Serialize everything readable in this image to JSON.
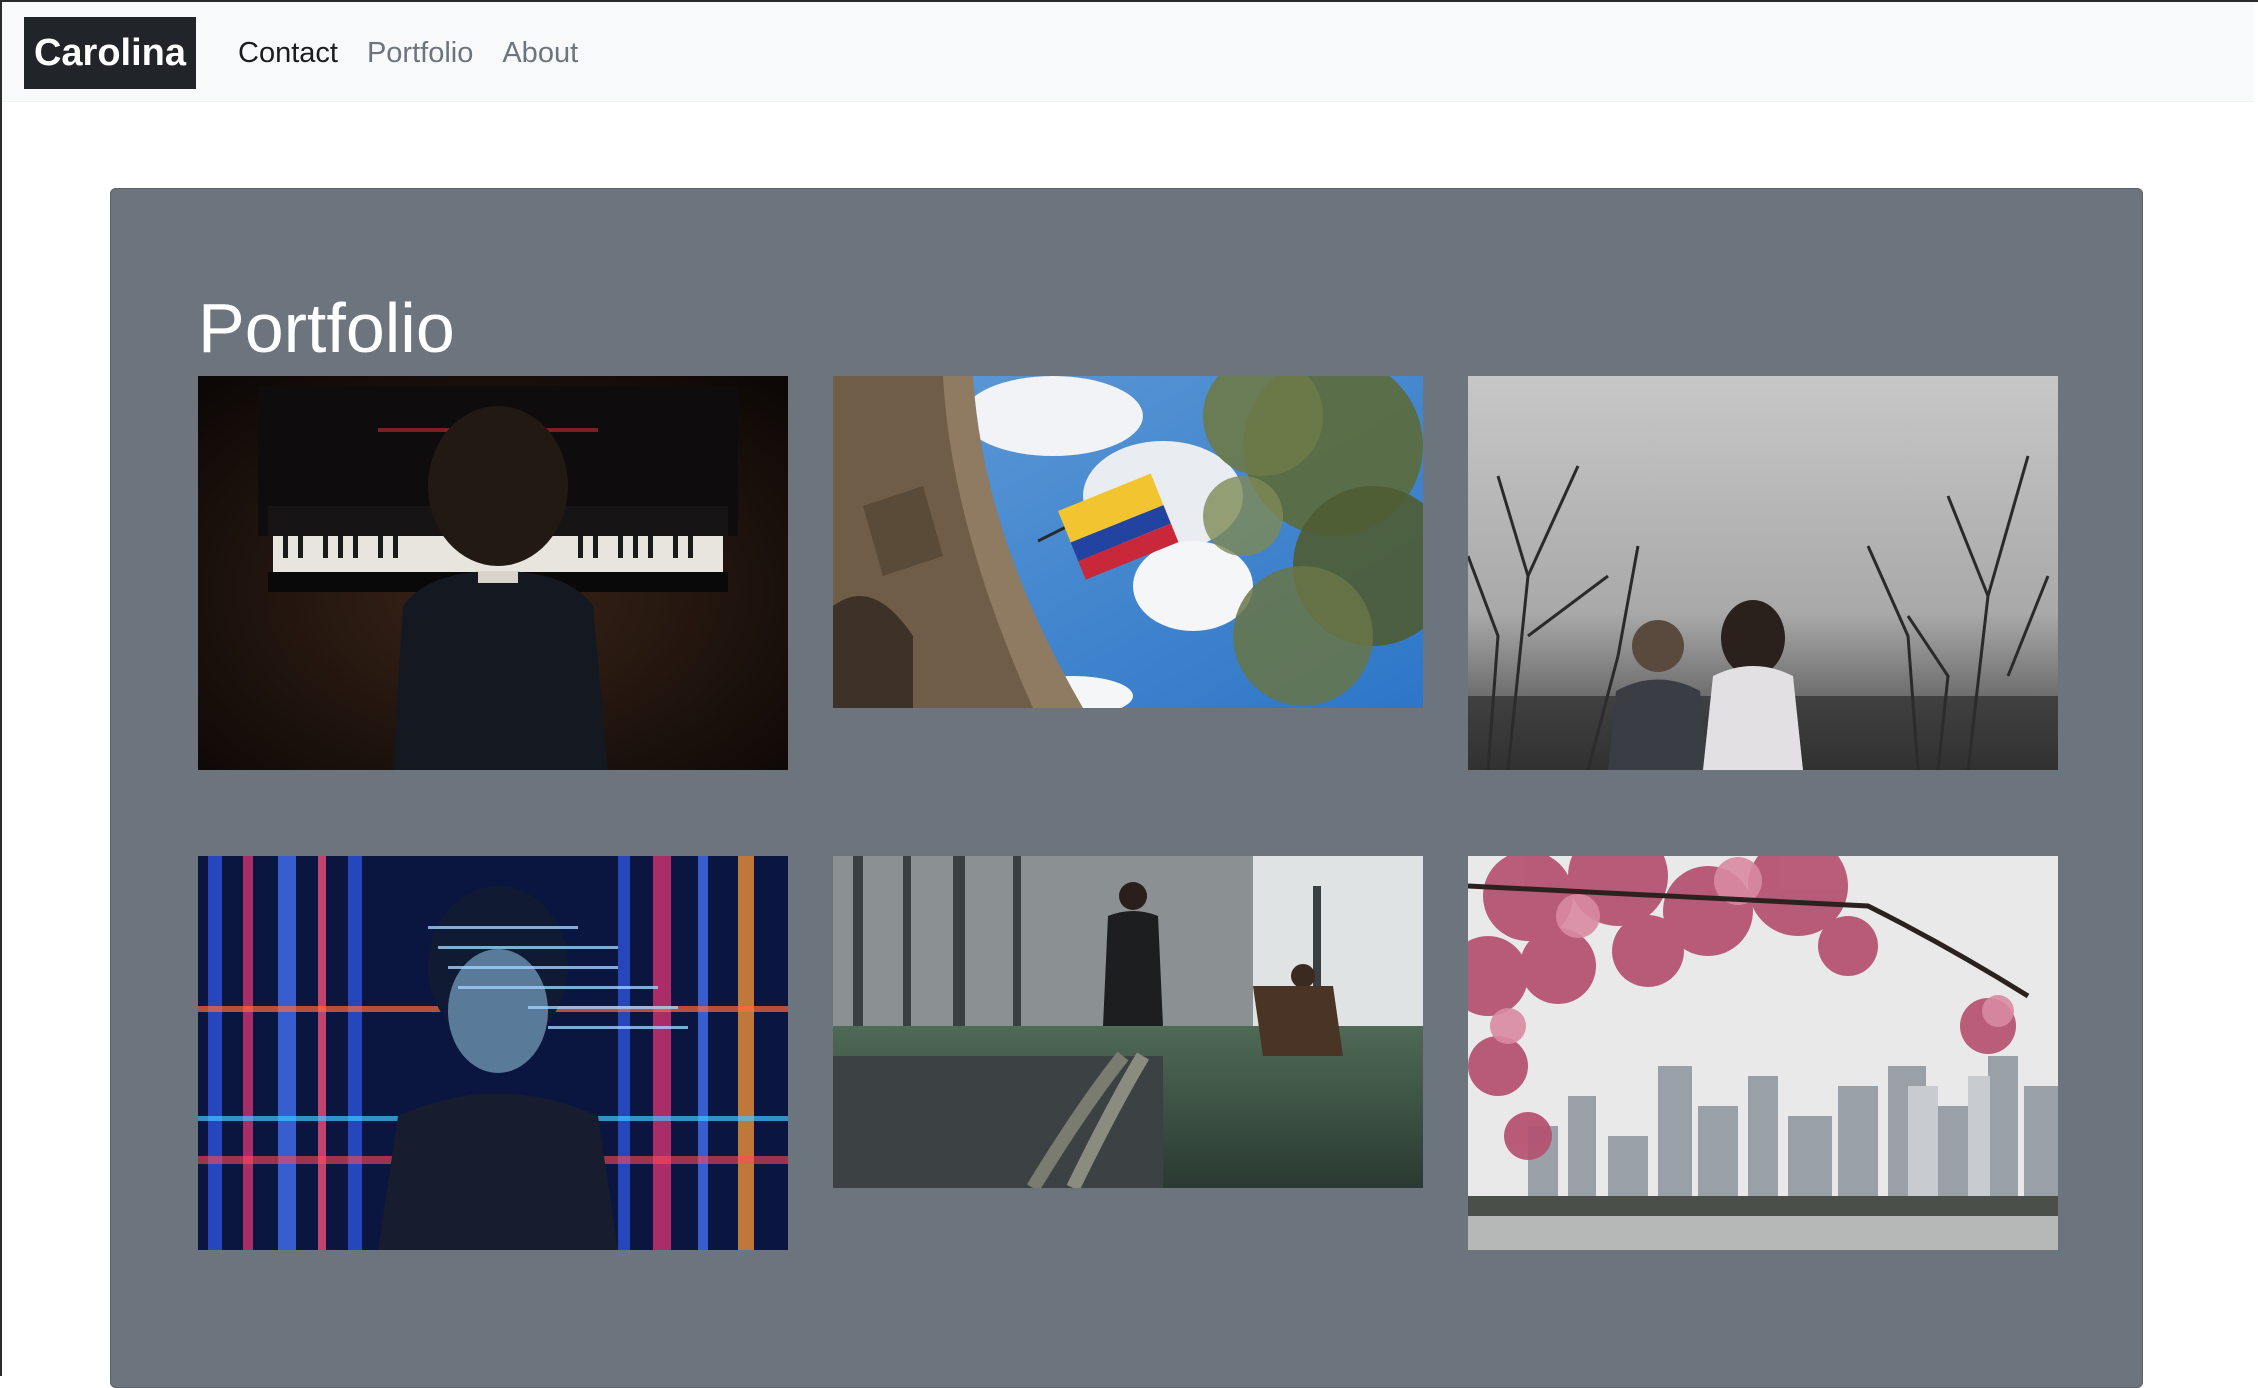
{
  "navbar": {
    "brand": "Carolina",
    "links": [
      {
        "label": "Contact",
        "active": true
      },
      {
        "label": "Portfolio",
        "active": false
      },
      {
        "label": "About",
        "active": false
      }
    ]
  },
  "main": {
    "title": "Portfolio",
    "panel_color": "#6c757d",
    "gallery": [
      {
        "subject": "child-playing-piano"
      },
      {
        "subject": "colombian-flag-building-trees"
      },
      {
        "subject": "two-children-bare-branches"
      },
      {
        "subject": "woman-with-code-projection"
      },
      {
        "subject": "gym-battle-ropes"
      },
      {
        "subject": "cherry-blossoms-city-skyline"
      }
    ]
  },
  "colors": {
    "navbar_bg": "#f8f9fa",
    "brand_bg": "#212529",
    "link_muted": "#6c757d",
    "link_active": "#1c1c1c"
  }
}
